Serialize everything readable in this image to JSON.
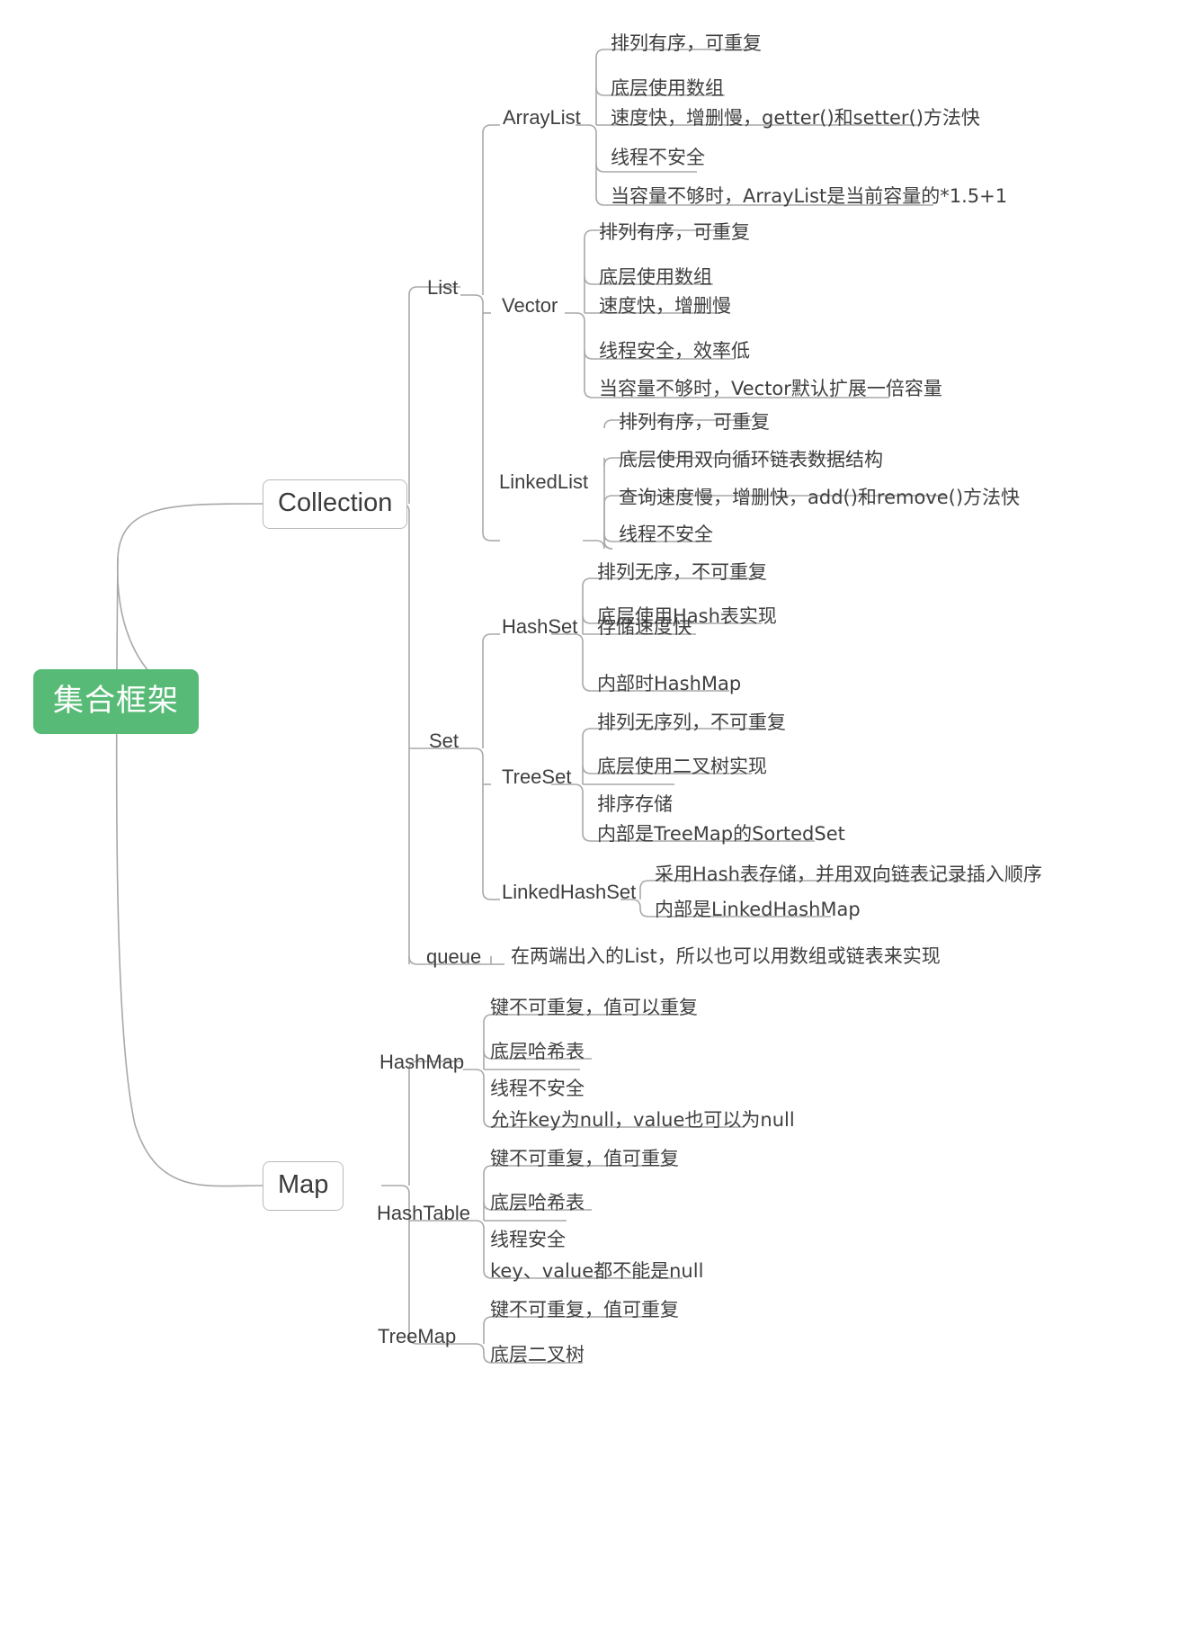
{
  "diagram": {
    "title": "集合框架",
    "type": "mindmap",
    "colors": {
      "root_fill": "#57bb77",
      "root_text": "#ffffff",
      "node_text": "#3f3f3f",
      "link_stroke": "#a8a8a8",
      "node_border": "#b9b9b9",
      "background": "#ffffff"
    }
  },
  "root": {
    "label": "集合框架"
  },
  "branches": [
    {
      "label": "Collection",
      "children": [
        {
          "label": "List",
          "children": [
            {
              "label": "ArrayList",
              "leaves": [
                "排列有序，可重复",
                "底层使用数组",
                "速度快，增删慢，getter()和setter()方法快",
                "线程不安全",
                "当容量不够时，ArrayList是当前容量的*1.5+1"
              ]
            },
            {
              "label": "Vector",
              "leaves": [
                "排列有序，可重复",
                "底层使用数组",
                "速度快，增删慢",
                "线程安全，效率低",
                "当容量不够时，Vector默认扩展一倍容量"
              ]
            },
            {
              "label": "LinkedList",
              "leaves": [
                "排列有序，可重复",
                "底层使用双向循环链表数据结构",
                "查询速度慢，增删快，add()和remove()方法快",
                "线程不安全"
              ]
            }
          ]
        },
        {
          "label": "Set",
          "children": [
            {
              "label": "HashSet",
              "leaves": [
                "排列无序，不可重复",
                "底层使用Hash表实现",
                "存储速度快",
                "内部时HashMap"
              ]
            },
            {
              "label": "TreeSet",
              "leaves": [
                "排列无序列，不可重复",
                "底层使用二叉树实现",
                "排序存储",
                "内部是TreeMap的SortedSet"
              ]
            },
            {
              "label": "LinkedHashSet",
              "leaves": [
                "采用Hash表存储，并用双向链表记录插入顺序",
                "内部是LinkedHashMap"
              ]
            }
          ]
        },
        {
          "label": "queue",
          "children": [],
          "leaves": [
            "在两端出入的List，所以也可以用数组或链表来实现"
          ]
        }
      ]
    },
    {
      "label": "Map",
      "children": [
        {
          "label": "HashMap",
          "leaves": [
            "键不可重复，值可以重复",
            "底层哈希表",
            "线程不安全",
            "允许key为null，value也可以为null"
          ]
        },
        {
          "label": "HashTable",
          "leaves": [
            "键不可重复，值可重复",
            "底层哈希表",
            "线程安全",
            "key、value都不能是null"
          ]
        },
        {
          "label": "TreeMap",
          "leaves": [
            "键不可重复，值可重复",
            "底层二叉树"
          ]
        }
      ]
    }
  ],
  "nodes": {
    "root": {
      "label": "集合框架"
    },
    "collection": {
      "label": "Collection"
    },
    "map": {
      "label": "Map"
    },
    "list": {
      "label": "List"
    },
    "set": {
      "label": "Set"
    },
    "queue": {
      "label": "queue"
    },
    "arraylist": {
      "label": "ArrayList"
    },
    "vector": {
      "label": "Vector"
    },
    "linkedlist": {
      "label": "LinkedList"
    },
    "hashset": {
      "label": "HashSet"
    },
    "treeset": {
      "label": "TreeSet"
    },
    "linkedhashset": {
      "label": "LinkedHashSet"
    },
    "hashmap": {
      "label": "HashMap"
    },
    "hashtable": {
      "label": "HashTable"
    },
    "treemap": {
      "label": "TreeMap"
    },
    "al1": {
      "label": "排列有序，可重复"
    },
    "al2": {
      "label": "底层使用数组"
    },
    "al3": {
      "label": "速度快，增删慢，getter()和setter()方法快"
    },
    "al4": {
      "label": "线程不安全"
    },
    "al5": {
      "label": "当容量不够时，ArrayList是当前容量的*1.5+1"
    },
    "v1": {
      "label": "排列有序，可重复"
    },
    "v2": {
      "label": "底层使用数组"
    },
    "v3": {
      "label": "速度快，增删慢"
    },
    "v4": {
      "label": "线程安全，效率低"
    },
    "v5": {
      "label": "当容量不够时，Vector默认扩展一倍容量"
    },
    "ll1": {
      "label": "排列有序，可重复"
    },
    "ll2": {
      "label": "底层使用双向循环链表数据结构"
    },
    "ll3": {
      "label": "查询速度慢，增删快，add()和remove()方法快"
    },
    "ll4": {
      "label": "线程不安全"
    },
    "hs1": {
      "label": "排列无序，不可重复"
    },
    "hs2": {
      "label": "底层使用Hash表实现"
    },
    "hs3": {
      "label": "存储速度快"
    },
    "hs4": {
      "label": "内部时HashMap"
    },
    "ts1": {
      "label": "排列无序列，不可重复"
    },
    "ts2": {
      "label": "底层使用二叉树实现"
    },
    "ts3": {
      "label": "排序存储"
    },
    "ts4": {
      "label": "内部是TreeMap的SortedSet"
    },
    "lhs1": {
      "label": "采用Hash表存储，并用双向链表记录插入顺序"
    },
    "lhs2": {
      "label": "内部是LinkedHashMap"
    },
    "q1": {
      "label": "在两端出入的List，所以也可以用数组或链表来实现"
    },
    "hm1": {
      "label": "键不可重复，值可以重复"
    },
    "hm2": {
      "label": "底层哈希表"
    },
    "hm3": {
      "label": "线程不安全"
    },
    "hm4": {
      "label": "允许key为null，value也可以为null"
    },
    "ht1": {
      "label": "键不可重复，值可重复"
    },
    "ht2": {
      "label": "底层哈希表"
    },
    "ht3": {
      "label": "线程安全"
    },
    "ht4": {
      "label": "key、value都不能是null"
    },
    "tm1": {
      "label": "键不可重复，值可重复"
    },
    "tm2": {
      "label": "底层二叉树"
    }
  }
}
